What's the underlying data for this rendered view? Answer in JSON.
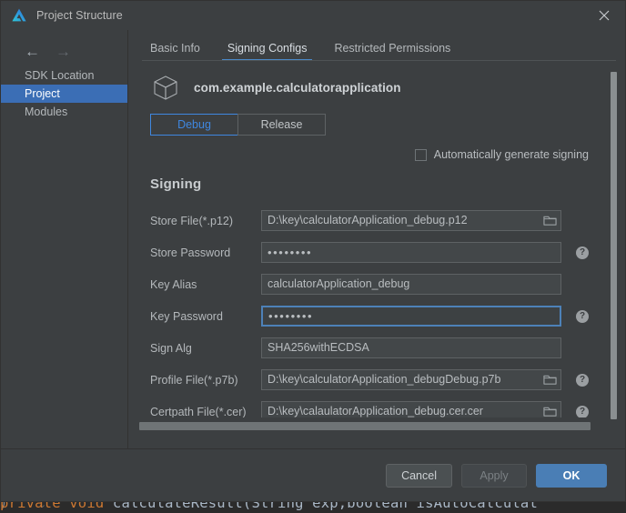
{
  "editor": {
    "code_prefix": "private void ",
    "code_fn": "calculateResult",
    "code_suffix": "(String exp,boolean isAutoCalculat",
    "fold_glyph": "⌄",
    "gutter_glyph": ")"
  },
  "titlebar": {
    "title": "Project Structure",
    "logo_icon": "deveco-logo-icon",
    "close_icon": "close-icon"
  },
  "sidebar": {
    "back_icon": "arrow-left-icon",
    "forward_icon": "arrow-right-icon",
    "items": [
      {
        "label": "SDK Location",
        "selected": false
      },
      {
        "label": "Project",
        "selected": true
      },
      {
        "label": "Modules",
        "selected": false
      }
    ]
  },
  "tabs": [
    {
      "label": "Basic Info",
      "active": false
    },
    {
      "label": "Signing Configs",
      "active": true
    },
    {
      "label": "Restricted Permissions",
      "active": false
    }
  ],
  "app_header": {
    "cube_icon": "cube-icon",
    "package_name": "com.example.calculatorapplication"
  },
  "variants": [
    {
      "label": "Debug",
      "selected": true
    },
    {
      "label": "Release",
      "selected": false
    }
  ],
  "autogen": {
    "label": "Automatically generate signing",
    "checked": false
  },
  "signing": {
    "section_title": "Signing",
    "fields": [
      {
        "label": "Store File(*.p12)",
        "value": "D:\\key\\calculatorApplication_debug.p12",
        "type": "text",
        "folder": true,
        "help": false,
        "focused": false
      },
      {
        "label": "Store Password",
        "value": "••••••••",
        "type": "password",
        "folder": false,
        "help": true,
        "focused": false
      },
      {
        "label": "Key Alias",
        "value": "calculatorApplication_debug",
        "type": "text",
        "folder": false,
        "help": false,
        "focused": false
      },
      {
        "label": "Key Password",
        "value": "••••••••",
        "type": "password",
        "folder": false,
        "help": true,
        "focused": true
      },
      {
        "label": "Sign Alg",
        "value": "SHA256withECDSA",
        "type": "text",
        "folder": false,
        "help": false,
        "focused": false
      },
      {
        "label": "Profile File(*.p7b)",
        "value": "D:\\key\\calculatorApplication_debugDebug.p7b",
        "type": "text",
        "folder": true,
        "help": true,
        "focused": false
      },
      {
        "label": "Certpath File(*.cer)",
        "value": "D:\\key\\calaulatorApplication_debug.cer.cer",
        "type": "text",
        "folder": true,
        "help": true,
        "focused": false
      }
    ],
    "help_glyph": "?"
  },
  "footer": {
    "cancel_label": "Cancel",
    "apply_label": "Apply",
    "ok_label": "OK"
  },
  "colors": {
    "accent_blue": "#3f87e0",
    "selection_blue": "#3b6eb5",
    "ok_button": "#4a7eb5",
    "panel_bg": "#3c3f41",
    "field_bg": "#434749",
    "tab_underline": "#4a88c7",
    "code_keyword": "#cc7832",
    "code_text": "#9da5b4"
  }
}
